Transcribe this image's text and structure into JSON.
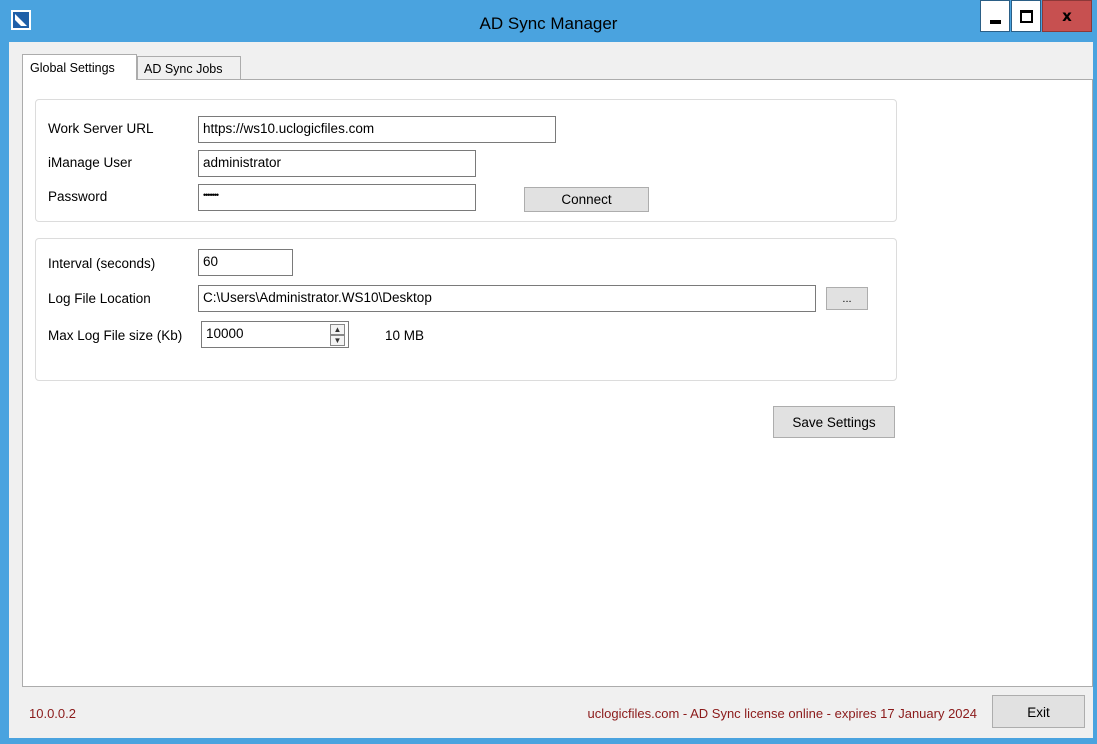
{
  "window": {
    "title": "AD Sync Manager",
    "controls": {
      "minimize": "minimize",
      "maximize": "maximize",
      "close": "x"
    }
  },
  "tabs": [
    {
      "label": "Global Settings",
      "active": true
    },
    {
      "label": "AD Sync Jobs",
      "active": false
    }
  ],
  "connection": {
    "work_server_url_label": "Work Server URL",
    "work_server_url_value": "https://ws10.uclogicfiles.com",
    "imanage_user_label": "iManage User",
    "imanage_user_value": "administrator",
    "password_label": "Password",
    "password_value": "•••••••",
    "connect_label": "Connect"
  },
  "logging": {
    "interval_label": "Interval (seconds)",
    "interval_value": "60",
    "log_file_location_label": "Log File Location",
    "log_file_location_value": "C:\\Users\\Administrator.WS10\\Desktop",
    "browse_label": "...",
    "max_log_size_label": "Max Log File size (Kb)",
    "max_log_size_value": "10000",
    "max_log_size_readout": "10 MB"
  },
  "save_settings_label": "Save Settings",
  "status": {
    "version": "10.0.0.2",
    "license": "uclogicfiles.com - AD Sync license online - expires 17 January 2024"
  },
  "exit_label": "Exit",
  "colors": {
    "title_bar": "#4aa3df",
    "close_button": "#c75050",
    "status_text": "#8b1a1a"
  },
  "icons": [
    "app-logo-icon",
    "minimize-icon",
    "maximize-icon",
    "close-icon",
    "chevron-up-icon",
    "chevron-down-icon"
  ]
}
